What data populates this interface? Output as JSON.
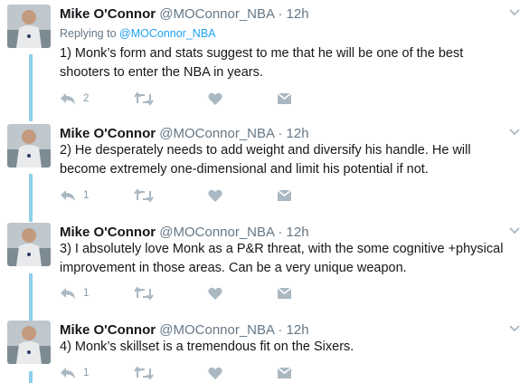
{
  "colors": {
    "thread_line": "#8ecfe8",
    "icon": "#aab8c2",
    "link": "#1da1f2",
    "meta": "#657786"
  },
  "icons": {
    "reply": "reply-icon",
    "retweet": "retweet-icon",
    "like": "heart-icon",
    "dm": "envelope-icon",
    "more": "chevron-down-icon"
  },
  "tweets": [
    {
      "name": "Mike O'Connor",
      "handle": "@MOConnor_NBA",
      "dot": "·",
      "time": "12h",
      "replying_prefix": "Replying to ",
      "replying_to": "@MOConnor_NBA",
      "text": "1) Monk’s form and stats suggest to me that he will be one of the best shooters to enter the NBA in years.",
      "reply_count": "2"
    },
    {
      "name": "Mike O'Connor",
      "handle": "@MOConnor_NBA",
      "dot": "·",
      "time": "12h",
      "text": "2) He desperately needs to add weight and diversify his handle. He will become extremely one-dimensional and limit his potential if not.",
      "reply_count": "1"
    },
    {
      "name": "Mike O'Connor",
      "handle": "@MOConnor_NBA",
      "dot": "·",
      "time": "12h",
      "text": "3) I absolutely love Monk as a P&R threat, with the some cognitive +physical improvement in those areas. Can be a very unique weapon.",
      "reply_count": "1"
    },
    {
      "name": "Mike O'Connor",
      "handle": "@MOConnor_NBA",
      "dot": "·",
      "time": "12h",
      "text": "4) Monk’s skillset is a tremendous fit on the Sixers.",
      "reply_count": "1"
    }
  ]
}
